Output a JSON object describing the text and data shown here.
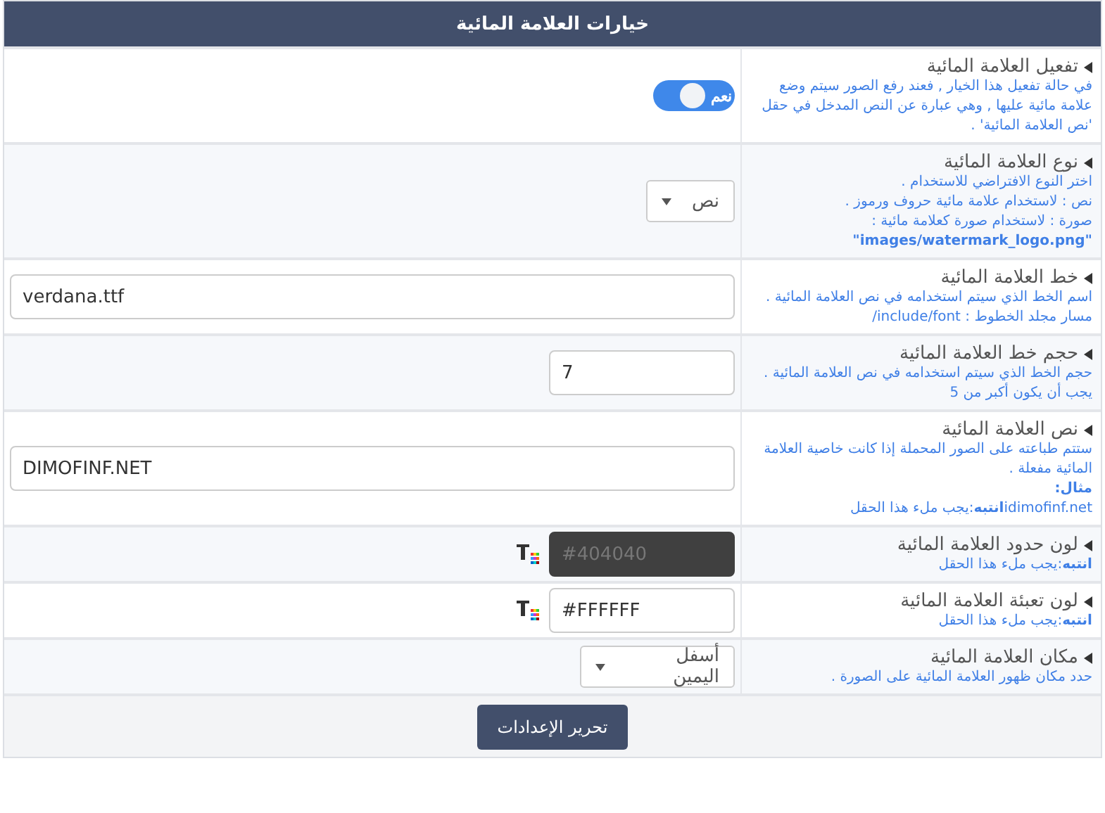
{
  "panel": {
    "title": "خيارات العلامة المائية"
  },
  "rows": [
    {
      "title": "تفعيل العلامة المائية",
      "notes": [
        "في حالة تفعيل هذا الخيار , فعند رفع الصور سيتم وضع علامة مائية عليها , وهي عبارة عن النص المدخل في حقل 'نص العلامة المائية' ."
      ],
      "control": {
        "kind": "toggle",
        "on": true,
        "label": "نعم"
      }
    },
    {
      "title": "نوع العلامة المائية",
      "notes": [
        "اختر النوع الافتراضي للاستخدام .",
        "نص : لاستخدام علامة مائية حروف ورموز .",
        "صورة : لاستخدام صورة كعلامة مائية :",
        "**\"images/watermark_logo.png\"**"
      ],
      "control": {
        "kind": "select",
        "value": "نص"
      }
    },
    {
      "title": "خط العلامة المائية",
      "notes": [
        "اسم الخط الذي سيتم استخدامه في نص العلامة المائية .",
        "مسار مجلد الخطوط : include/font/"
      ],
      "control": {
        "kind": "text",
        "value": "verdana.ttf"
      }
    },
    {
      "title": "حجم خط العلامة المائية",
      "notes": [
        "حجم الخط الذي سيتم استخدامه في نص العلامة المائية .",
        "يجب أن يكون أكبر من 5"
      ],
      "control": {
        "kind": "number",
        "value": "7"
      }
    },
    {
      "title": "نص العلامة المائية",
      "notes": [
        "ستتم طباعته على الصور المحملة إذا كانت خاصية العلامة المائية مفعلة .",
        "**مثال:**",
        "idimofinf.net**انتبه**:يجب ملء هذا الحقل"
      ],
      "control": {
        "kind": "text",
        "value": "DIMOFINF.NET"
      }
    },
    {
      "title": "لون حدود العلامة المائية",
      "notes": [
        "**انتبه**:يجب ملء هذا الحقل"
      ],
      "control": {
        "kind": "color",
        "value": "#404040",
        "color": "#404040"
      }
    },
    {
      "title": "لون تعبئة العلامة المائية",
      "notes": [
        "**انتبه**:يجب ملء هذا الحقل"
      ],
      "control": {
        "kind": "color",
        "value": "#FFFFFF",
        "color": "#ffffff"
      }
    },
    {
      "title": "مكان العلامة المائية",
      "notes": [
        "حدد مكان ظهور العلامة المائية على الصورة ."
      ],
      "control": {
        "kind": "select",
        "value": "أسفل اليمين"
      }
    }
  ],
  "submit": {
    "label": "تحرير الإعدادات"
  }
}
